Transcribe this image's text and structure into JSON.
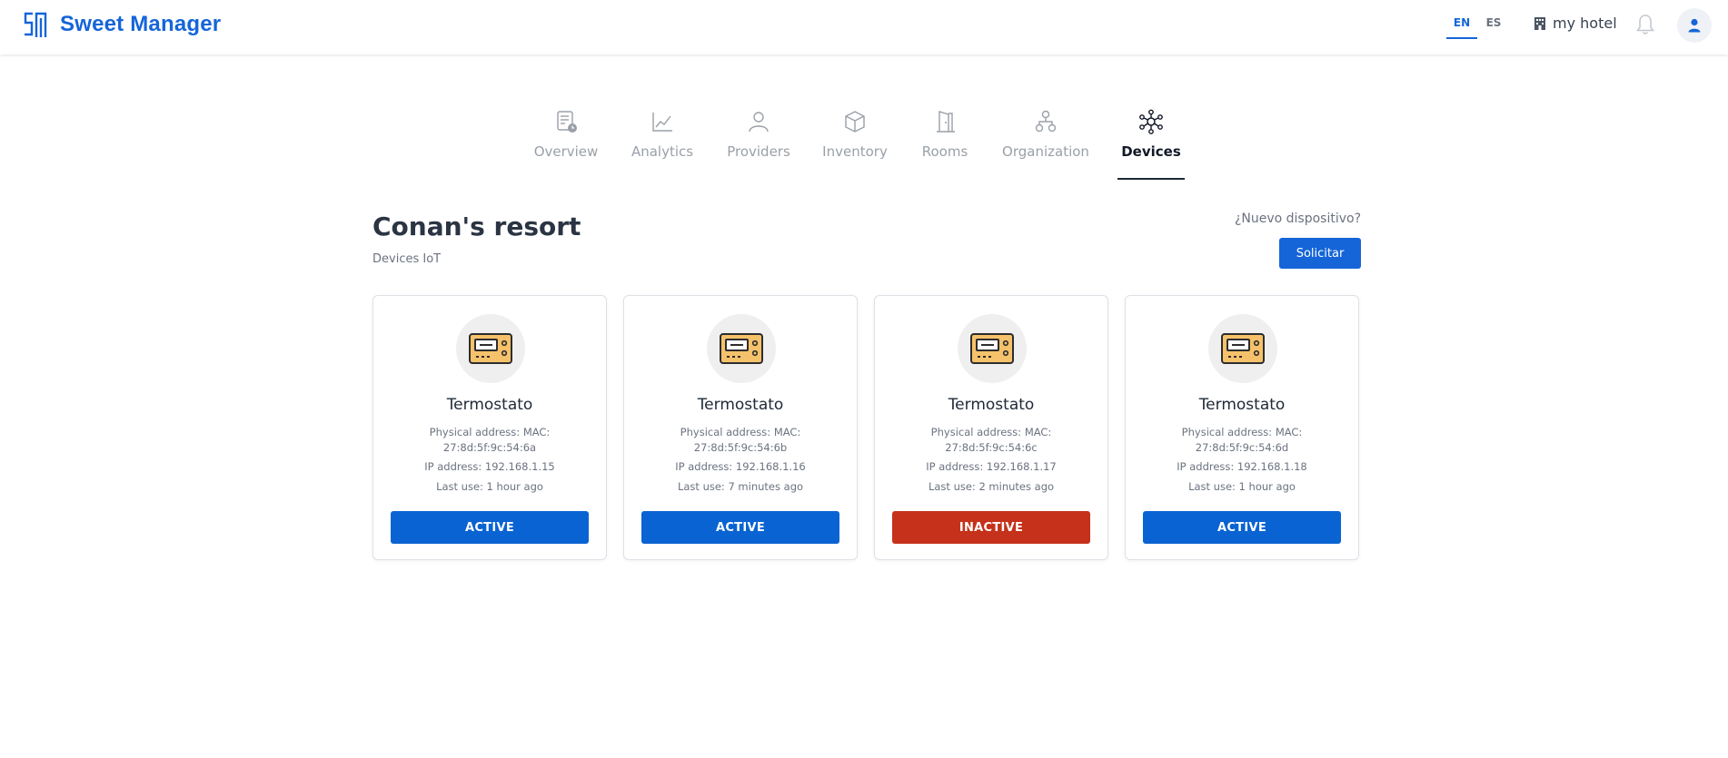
{
  "app": {
    "name": "Sweet Manager"
  },
  "header": {
    "languages": [
      {
        "code": "EN",
        "active": true
      },
      {
        "code": "ES",
        "active": false
      }
    ],
    "hotel_label": "my hotel",
    "hotel_icon": "building-icon",
    "notification_icon": "bell-icon",
    "profile_icon": "user-icon"
  },
  "nav": {
    "tabs": [
      {
        "label": "Overview",
        "icon": "report-icon",
        "active": false
      },
      {
        "label": "Analytics",
        "icon": "chart-line-icon",
        "active": false
      },
      {
        "label": "Providers",
        "icon": "person-icon",
        "active": false
      },
      {
        "label": "Inventory",
        "icon": "box-icon",
        "active": false
      },
      {
        "label": "Rooms",
        "icon": "door-icon",
        "active": false
      },
      {
        "label": "Organization",
        "icon": "org-chart-icon",
        "active": false
      },
      {
        "label": "Devices",
        "icon": "network-hub-icon",
        "active": true
      }
    ]
  },
  "page": {
    "title": "Conan's resort",
    "subtitle": "Devices IoT",
    "new_device_label": "¿Nuevo dispositivo?",
    "request_button": "Solicitar"
  },
  "devices": [
    {
      "name": "Termostato",
      "mac_label": "Physical address: MAC:",
      "mac": "27:8d:5f:9c:54:6a",
      "ip": "IP address: 192.168.1.15",
      "last_use": "Last use: 1 hour ago",
      "status": "ACTIVE"
    },
    {
      "name": "Termostato",
      "mac_label": "Physical address: MAC:",
      "mac": "27:8d:5f:9c:54:6b",
      "ip": "IP address: 192.168.1.16",
      "last_use": "Last use: 7 minutes ago",
      "status": "ACTIVE"
    },
    {
      "name": "Termostato",
      "mac_label": "Physical address: MAC:",
      "mac": "27:8d:5f:9c:54:6c",
      "ip": "IP address: 192.168.1.17",
      "last_use": "Last use: 2 minutes ago",
      "status": "INACTIVE"
    },
    {
      "name": "Termostato",
      "mac_label": "Physical address: MAC:",
      "mac": "27:8d:5f:9c:54:6d",
      "ip": "IP address: 192.168.1.18",
      "last_use": "Last use: 1 hour ago",
      "status": "ACTIVE"
    }
  ],
  "colors": {
    "brand": "#1565d8",
    "active": "#0a63d2",
    "inactive": "#c5311a",
    "thermostat_body": "#f5c26b"
  }
}
